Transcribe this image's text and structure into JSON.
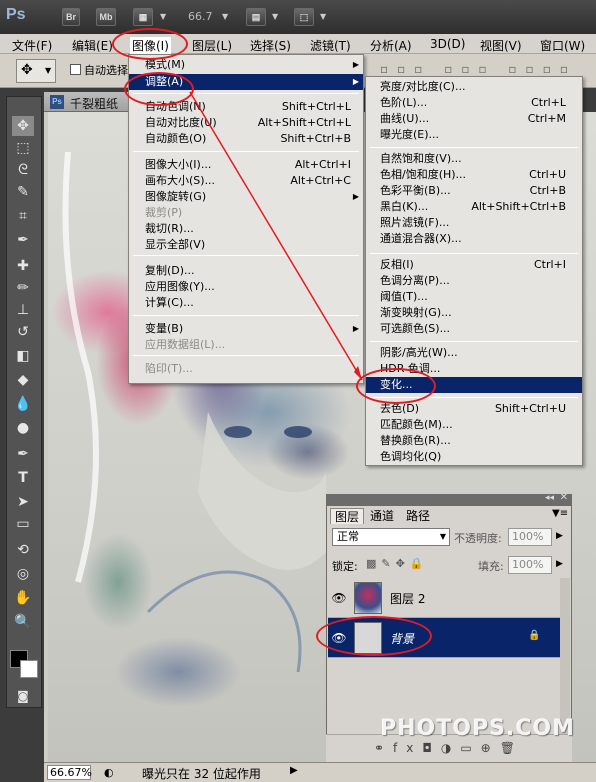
{
  "app": {
    "logo": "Ps",
    "br_label": "Br",
    "mb_label": "Mb",
    "zoom": "66.7"
  },
  "menubar": {
    "items": [
      "文件(F)",
      "编辑(E)",
      "图像(I)",
      "图层(L)",
      "选择(S)",
      "滤镜(T)",
      "分析(A)",
      "3D(D)",
      "视图(V)",
      "窗口(W)"
    ],
    "active": "图像(I)"
  },
  "options_bar": {
    "auto_select_label": "自动选择"
  },
  "document": {
    "tab_icon": "Ps",
    "title": "千裂粗纸"
  },
  "image_menu": {
    "items": [
      {
        "label": "模式(M)",
        "shortcut": "",
        "submenu": true,
        "disabled": false
      },
      {
        "label": "调整(A)",
        "shortcut": "",
        "submenu": true,
        "disabled": false,
        "active": true
      },
      {
        "label": "自动色调(N)",
        "shortcut": "Shift+Ctrl+L",
        "disabled": false
      },
      {
        "label": "自动对比度(U)",
        "shortcut": "Alt+Shift+Ctrl+L",
        "disabled": false
      },
      {
        "label": "自动颜色(O)",
        "shortcut": "Shift+Ctrl+B",
        "disabled": false
      },
      {
        "label": "图像大小(I)...",
        "shortcut": "Alt+Ctrl+I",
        "disabled": false
      },
      {
        "label": "画布大小(S)...",
        "shortcut": "Alt+Ctrl+C",
        "disabled": false
      },
      {
        "label": "图像旋转(G)",
        "shortcut": "",
        "submenu": true,
        "disabled": false
      },
      {
        "label": "裁剪(P)",
        "shortcut": "",
        "disabled": true
      },
      {
        "label": "裁切(R)...",
        "shortcut": "",
        "disabled": false
      },
      {
        "label": "显示全部(V)",
        "shortcut": "",
        "disabled": false
      },
      {
        "label": "复制(D)...",
        "shortcut": "",
        "disabled": false
      },
      {
        "label": "应用图像(Y)...",
        "shortcut": "",
        "disabled": false
      },
      {
        "label": "计算(C)...",
        "shortcut": "",
        "disabled": false
      },
      {
        "label": "变量(B)",
        "shortcut": "",
        "submenu": true,
        "disabled": false
      },
      {
        "label": "应用数据组(L)...",
        "shortcut": "",
        "disabled": true
      },
      {
        "label": "陷印(T)...",
        "shortcut": "",
        "disabled": true
      }
    ]
  },
  "adjust_menu": {
    "items": [
      {
        "label": "亮度/对比度(C)...",
        "shortcut": ""
      },
      {
        "label": "色阶(L)...",
        "shortcut": "Ctrl+L"
      },
      {
        "label": "曲线(U)...",
        "shortcut": "Ctrl+M"
      },
      {
        "label": "曝光度(E)...",
        "shortcut": ""
      },
      {
        "label": "自然饱和度(V)...",
        "shortcut": ""
      },
      {
        "label": "色相/饱和度(H)...",
        "shortcut": "Ctrl+U"
      },
      {
        "label": "色彩平衡(B)...",
        "shortcut": "Ctrl+B"
      },
      {
        "label": "黑白(K)...",
        "shortcut": "Alt+Shift+Ctrl+B"
      },
      {
        "label": "照片滤镜(F)...",
        "shortcut": ""
      },
      {
        "label": "通道混合器(X)...",
        "shortcut": ""
      },
      {
        "label": "反相(I)",
        "shortcut": "Ctrl+I"
      },
      {
        "label": "色调分离(P)...",
        "shortcut": ""
      },
      {
        "label": "阈值(T)...",
        "shortcut": ""
      },
      {
        "label": "渐变映射(G)...",
        "shortcut": ""
      },
      {
        "label": "可选颜色(S)...",
        "shortcut": ""
      },
      {
        "label": "阴影/高光(W)...",
        "shortcut": ""
      },
      {
        "label": "HDR 色调...",
        "shortcut": ""
      },
      {
        "label": "变化...",
        "shortcut": "",
        "active": true
      },
      {
        "label": "去色(D)",
        "shortcut": "Shift+Ctrl+U"
      },
      {
        "label": "匹配颜色(M)...",
        "shortcut": ""
      },
      {
        "label": "替换颜色(R)...",
        "shortcut": ""
      },
      {
        "label": "色调均化(Q)",
        "shortcut": ""
      }
    ]
  },
  "layers_panel": {
    "tabs": [
      "图层",
      "通道",
      "路径"
    ],
    "active_tab": "图层",
    "blend_mode": "正常",
    "opacity_label": "不透明度:",
    "opacity_value": "100%",
    "lock_label": "锁定:",
    "fill_label": "填充:",
    "fill_value": "100%",
    "layers": [
      {
        "name": "图层 2",
        "selected": false
      },
      {
        "name": "背景",
        "selected": true
      }
    ]
  },
  "status": {
    "zoom": "66.67%",
    "text": "曝光只在 32 位起作用"
  },
  "watermark": "PHOTOPS.COM",
  "colors": {
    "menu_highlight": "#0a246a",
    "annotation": "#e11b22",
    "app_dark": "#3c3c3c"
  }
}
